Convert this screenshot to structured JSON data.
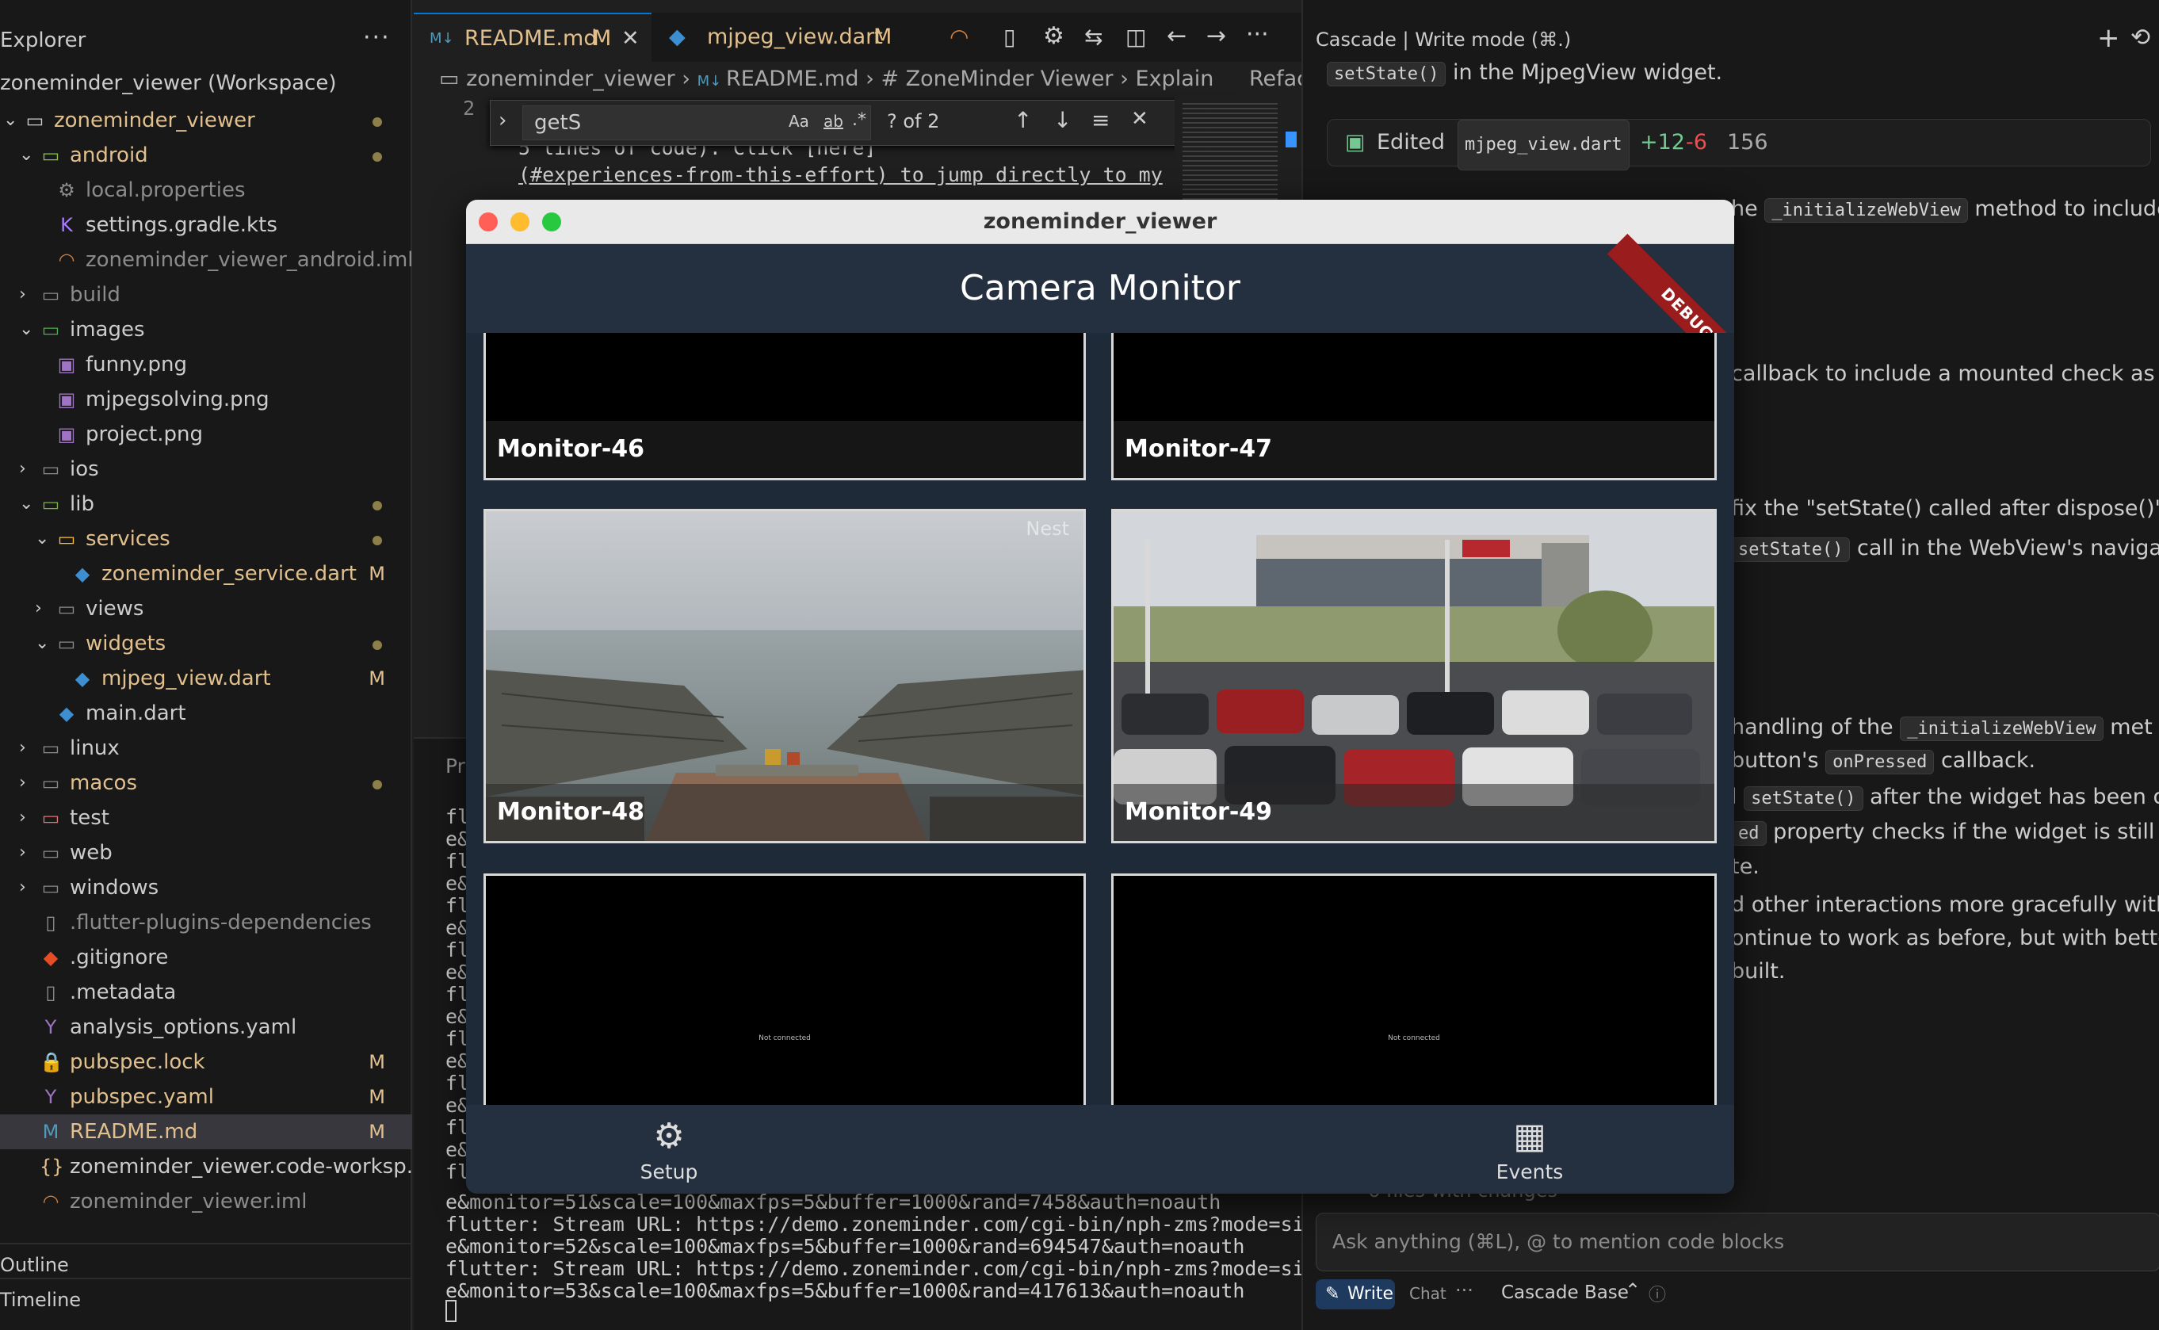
{
  "explorer": {
    "title": "Explorer",
    "more": "···",
    "workspace": "zoneminder_viewer (Workspace)",
    "tree": [
      {
        "label": "zoneminder_viewer",
        "icon": "folder-root-icon",
        "chev": "⌄",
        "badge": "dot",
        "color": "#e2c08d"
      },
      {
        "label": "android",
        "icon": "folder-android-icon",
        "chev": "⌄",
        "badge": "dot",
        "color": "#e2c08d"
      },
      {
        "label": "local.properties",
        "icon": "gear-icon",
        "chev": "",
        "badge": "",
        "color": "#8b8b8b"
      },
      {
        "label": "settings.gradle.kts",
        "icon": "kotlin-icon",
        "chev": "",
        "badge": "",
        "color": "#cccccc"
      },
      {
        "label": "zoneminder_viewer_android.iml",
        "icon": "rss-icon",
        "chev": "",
        "badge": "",
        "color": "#8b8b8b"
      },
      {
        "label": "build",
        "icon": "folder-icon",
        "chev": "›",
        "badge": "",
        "color": "#8b8b8b"
      },
      {
        "label": "images",
        "icon": "folder-images-icon",
        "chev": "⌄",
        "badge": "",
        "color": "#cccccc"
      },
      {
        "label": "funny.png",
        "icon": "image-icon",
        "chev": "",
        "badge": "",
        "color": "#cccccc"
      },
      {
        "label": "mjpegsolving.png",
        "icon": "image-icon",
        "chev": "",
        "badge": "",
        "color": "#cccccc"
      },
      {
        "label": "project.png",
        "icon": "image-icon",
        "chev": "",
        "badge": "",
        "color": "#cccccc"
      },
      {
        "label": "ios",
        "icon": "folder-icon",
        "chev": "›",
        "badge": "",
        "color": "#cccccc"
      },
      {
        "label": "lib",
        "icon": "folder-lib-icon",
        "chev": "⌄",
        "badge": "dot",
        "color": "#cccccc"
      },
      {
        "label": "services",
        "icon": "folder-services-icon",
        "chev": "⌄",
        "badge": "dot",
        "color": "#e2c08d"
      },
      {
        "label": "zoneminder_service.dart",
        "icon": "dart-icon",
        "chev": "",
        "badge": "M",
        "color": "#e2c08d"
      },
      {
        "label": "views",
        "icon": "folder-icon",
        "chev": "›",
        "badge": "",
        "color": "#cccccc"
      },
      {
        "label": "widgets",
        "icon": "folder-icon",
        "chev": "⌄",
        "badge": "dot",
        "color": "#e2c08d"
      },
      {
        "label": "mjpeg_view.dart",
        "icon": "dart-icon",
        "chev": "",
        "badge": "M",
        "color": "#e2c08d"
      },
      {
        "label": "main.dart",
        "icon": "dart-icon",
        "chev": "",
        "badge": "",
        "color": "#cccccc"
      },
      {
        "label": "linux",
        "icon": "folder-icon",
        "chev": "›",
        "badge": "",
        "color": "#cccccc"
      },
      {
        "label": "macos",
        "icon": "folder-icon",
        "chev": "›",
        "badge": "dot",
        "color": "#e2c08d"
      },
      {
        "label": "test",
        "icon": "folder-test-icon",
        "chev": "›",
        "badge": "",
        "color": "#cccccc"
      },
      {
        "label": "web",
        "icon": "folder-icon",
        "chev": "›",
        "badge": "",
        "color": "#cccccc"
      },
      {
        "label": "windows",
        "icon": "folder-icon",
        "chev": "›",
        "badge": "",
        "color": "#cccccc"
      },
      {
        "label": ".flutter-plugins-dependencies",
        "icon": "file-icon",
        "chev": "",
        "badge": "",
        "color": "#8b8b8b"
      },
      {
        "label": ".gitignore",
        "icon": "git-icon",
        "chev": "",
        "badge": "",
        "color": "#cccccc"
      },
      {
        "label": ".metadata",
        "icon": "file-icon",
        "chev": "",
        "badge": "",
        "color": "#cccccc"
      },
      {
        "label": "analysis_options.yaml",
        "icon": "yaml-icon",
        "chev": "",
        "badge": "",
        "color": "#cccccc"
      },
      {
        "label": "pubspec.lock",
        "icon": "lock-icon",
        "chev": "",
        "badge": "M",
        "color": "#e2c08d"
      },
      {
        "label": "pubspec.yaml",
        "icon": "yaml-icon",
        "chev": "",
        "badge": "M",
        "color": "#e2c08d"
      },
      {
        "label": "README.md",
        "icon": "markdown-icon",
        "chev": "",
        "badge": "M",
        "color": "#e2c08d"
      },
      {
        "label": "zoneminder_viewer.code-worksp...",
        "icon": "json-icon",
        "chev": "",
        "badge": "",
        "color": "#cccccc"
      },
      {
        "label": "zoneminder_viewer.iml",
        "icon": "rss-icon",
        "chev": "",
        "badge": "",
        "color": "#8b8b8b"
      }
    ],
    "outline": "Outline",
    "timeline": "Timeline"
  },
  "editor": {
    "tabs": [
      {
        "label": "README.md",
        "badge": "M",
        "active": true
      },
      {
        "label": "mjpeg_view.dart",
        "badge": "M",
        "active": false
      }
    ],
    "breadcrumb": [
      "zoneminder_viewer",
      "README.md",
      "# ZoneMinder Viewer",
      "Explain",
      "Refac"
    ],
    "find": {
      "value": "getS",
      "count": "? of 2",
      "aa": "Aa",
      "ab": "ab",
      "regex": ".*"
    },
    "line_number": "2",
    "code_lines": [
      "5 lines of code). Click [here]",
      "(#experiences-from-this-effort) to jump directly to my"
    ],
    "terminal_lines": [
      "e&monitor=51&scale=100&maxfps=5&buffer=1000&rand=7458&auth=noauth",
      "flutter: Stream URL: https://demo.zoneminder.com/cgi-bin/nph-zms?mode=singl",
      "e&monitor=52&scale=100&maxfps=5&buffer=1000&rand=694547&auth=noauth",
      "flutter: Stream URL: https://demo.zoneminder.com/cgi-bin/nph-zms?mode=singl",
      "e&monitor=53&scale=100&maxfps=5&buffer=1000&rand=417613&auth=noauth"
    ],
    "terminal_cut": [
      "fl",
      "e&",
      "fl",
      "e&",
      "fl",
      "e&",
      "fl",
      "e&",
      "fl",
      "e&",
      "fl",
      "e&",
      "fl",
      "e&",
      "fl",
      "e&",
      "fl"
    ],
    "problems_label": "Pr"
  },
  "cascade": {
    "title": "Cascade | Write mode (⌘.)",
    "intro": "in the MjpegView widget.",
    "intro_code": "setState()",
    "edited": {
      "label": "Edited",
      "file": "mjpeg_view.dart",
      "add": "+12",
      "del": "-6",
      "num": "156"
    },
    "lines": [
      {
        "pre": "he ",
        "code": "_initializeWebView",
        "post": " method to include"
      },
      {
        "pre": "",
        "code": "",
        "post": "callback to include a mounted check as"
      },
      {
        "pre": "fix the \"setState() called after dispose()\" ",
        "code": "",
        "post": ""
      },
      {
        "pre": "",
        "code": "setState()",
        "post": " call in the WebView's navigati"
      },
      {
        "pre": "handling of the ",
        "code": "_initializeWebView",
        "post": " met"
      },
      {
        "pre": "button's ",
        "code": "onPressed",
        "post": " callback."
      },
      {
        "pre": "l ",
        "code": "setState()",
        "post": " after the widget has been dis"
      },
      {
        "pre": "",
        "code": "ed",
        "post": " property checks if the widget is still in"
      },
      {
        "pre": "te.",
        "code": "",
        "post": ""
      },
      {
        "pre": "d other interactions more gracefully witho",
        "code": "",
        "post": ""
      },
      {
        "pre": "ontinue to work as before, but with better s",
        "code": "",
        "post": ""
      },
      {
        "pre": "built.",
        "code": "",
        "post": ""
      }
    ],
    "files_changed": "6 files with changes",
    "input_placeholder": "Ask anything (⌘L), @ to mention code blocks",
    "mode_write": "Write",
    "mode_chat": "Chat",
    "base": "Cascade Base"
  },
  "app": {
    "window_title": "zoneminder_viewer",
    "appbar_title": "Camera Monitor",
    "debug": "DEBUG",
    "monitors": [
      {
        "name": "Monitor-46",
        "status": ""
      },
      {
        "name": "Monitor-47",
        "status": ""
      },
      {
        "name": "Monitor-48",
        "status": "Nest"
      },
      {
        "name": "Monitor-49",
        "status": ""
      },
      {
        "name": "",
        "status": "Not connected"
      },
      {
        "name": "",
        "status": "Not connected"
      }
    ],
    "nav": [
      {
        "label": "Setup",
        "icon": "gear-icon"
      },
      {
        "label": "Events",
        "icon": "calendar-icon"
      }
    ]
  }
}
